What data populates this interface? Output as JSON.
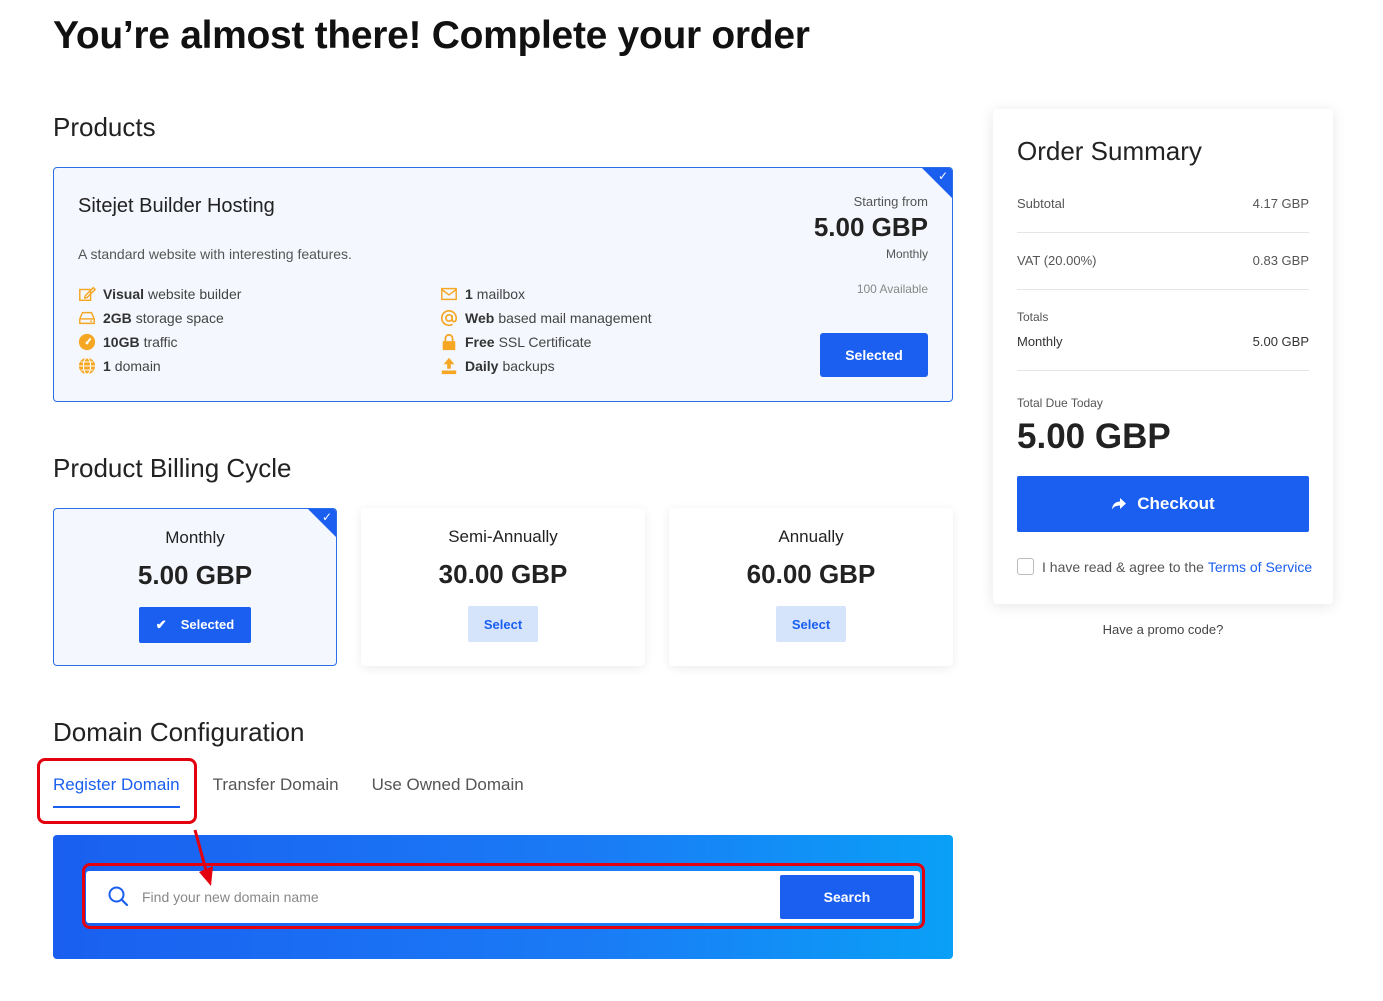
{
  "page_title": "You’re almost there! Complete your order",
  "products": {
    "section_title": "Products",
    "name": "Sitejet Builder Hosting",
    "description": "A standard website with interesting features.",
    "price_prefix": "Starting from",
    "price": "5.00 GBP",
    "cycle": "Monthly",
    "availability": "100 Available",
    "button_label": "Selected",
    "features_left": [
      {
        "bold": "Visual",
        "text": "website builder",
        "icon": "edit-icon"
      },
      {
        "bold": "2GB",
        "text": "storage space",
        "icon": "hard-drive-icon"
      },
      {
        "bold": "10GB",
        "text": "traffic",
        "icon": "speedometer-icon"
      },
      {
        "bold": "1",
        "text": "domain",
        "icon": "globe-icon"
      }
    ],
    "features_right": [
      {
        "bold": "1",
        "text": "mailbox",
        "icon": "envelope-icon"
      },
      {
        "bold": "Web",
        "text": "based mail management",
        "icon": "at-icon"
      },
      {
        "bold": "Free",
        "text": "SSL Certificate",
        "icon": "lock-icon"
      },
      {
        "bold": "Daily",
        "text": "backups",
        "icon": "upload-icon"
      }
    ]
  },
  "billing": {
    "section_title": "Product Billing Cycle",
    "options": [
      {
        "name": "Monthly",
        "price": "5.00 GBP",
        "button": "Selected",
        "selected": true
      },
      {
        "name": "Semi-Annually",
        "price": "30.00 GBP",
        "button": "Select",
        "selected": false
      },
      {
        "name": "Annually",
        "price": "60.00 GBP",
        "button": "Select",
        "selected": false
      }
    ]
  },
  "domain": {
    "section_title": "Domain Configuration",
    "tabs": [
      "Register Domain",
      "Transfer Domain",
      "Use Owned Domain"
    ],
    "active_tab": "Register Domain",
    "search_placeholder": "Find your new domain name",
    "search_button": "Search"
  },
  "summary": {
    "title": "Order Summary",
    "subtotal_label": "Subtotal",
    "subtotal_value": "4.17 GBP",
    "vat_label": "VAT (20.00%)",
    "vat_value": "0.83 GBP",
    "totals_label": "Totals",
    "monthly_label": "Monthly",
    "monthly_value": "5.00 GBP",
    "due_label": "Total Due Today",
    "due_value": "5.00 GBP",
    "checkout_label": "Checkout",
    "tos_text": "I have read & agree to the",
    "tos_link": "Terms of Service",
    "promo_text": "Have a promo code?"
  },
  "colors": {
    "accent": "#1a5ff0",
    "annotation": "#e3000f",
    "icon_orange": "#f5a623"
  }
}
